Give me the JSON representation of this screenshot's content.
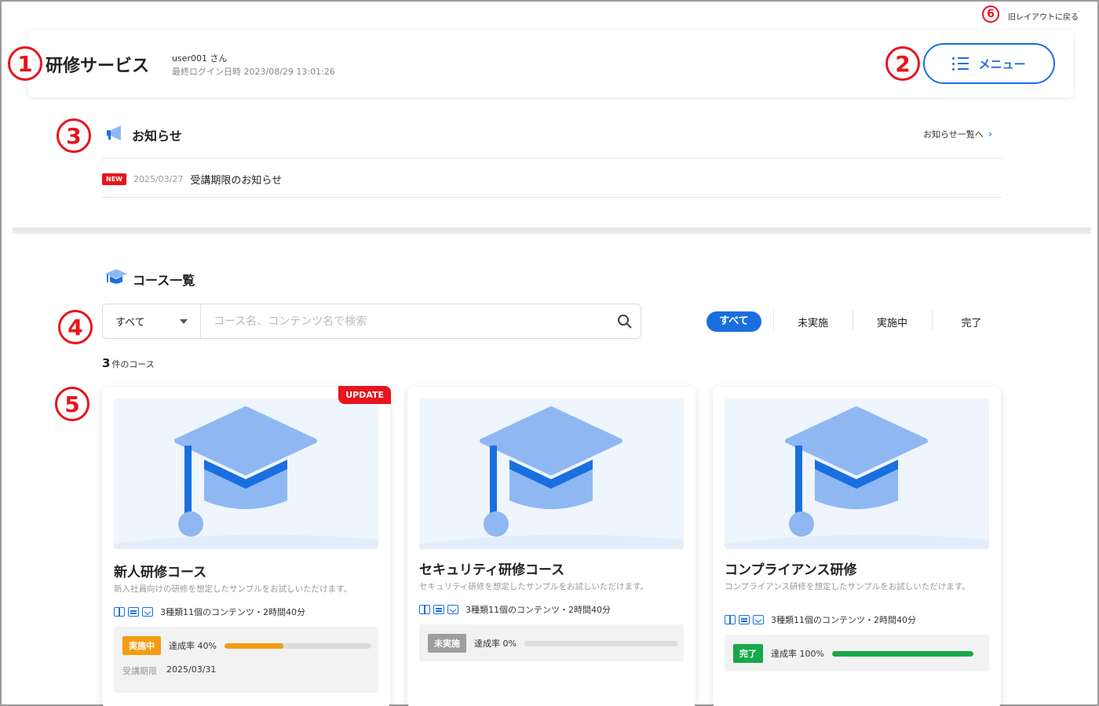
{
  "top_link": "旧レイアウトに戻る",
  "header": {
    "app_title": "研修サービス",
    "user": "user001 さん",
    "last_login": "最終ログイン日時 2023/08/29 13:01:26",
    "menu_label": "メニュー"
  },
  "markers": [
    "1",
    "2",
    "3",
    "4",
    "5",
    "6"
  ],
  "notice": {
    "title": "お知らせ",
    "list_link": "お知らせ一覧へ",
    "items": [
      {
        "badge": "NEW",
        "date": "2025/03/27",
        "text": "受講期限のお知らせ"
      }
    ]
  },
  "courses": {
    "title": "コース一覧",
    "search": {
      "select_value": "すべて",
      "placeholder": "コース名、コンテンツ名で検索"
    },
    "filters": [
      "すべて",
      "未実施",
      "実施中",
      "完了"
    ],
    "active_filter": "すべて",
    "count_number": "3",
    "count_suffix": "件のコース",
    "cards": [
      {
        "ribbon": "UPDATE",
        "name": "新人研修コース",
        "desc": "新入社員向けの研修を想定したサンプルをお試しいただけます。",
        "meta": "3種類11個のコンテンツ・2時間40分",
        "status": "実施中",
        "status_color": "#f39c12",
        "progress_label": "達成率 40%",
        "progress": 40,
        "bar_color": "#f39c12",
        "deadline_label": "受講期限",
        "deadline": "2025/03/31"
      },
      {
        "name": "セキュリティ研修コース",
        "desc": "セキュリティ研修を想定したサンプルをお試しいただけます。",
        "meta": "3種類11個のコンテンツ・2時間40分",
        "status": "未実施",
        "status_color": "#9e9e9e",
        "progress_label": "達成率 0%",
        "progress": 0,
        "bar_color": "#9e9e9e"
      },
      {
        "name": "コンプライアンス研修",
        "desc": "コンプライアンス研修を想定したサンプルをお試しいただけます。",
        "meta": "3種類11個のコンテンツ・2時間40分",
        "status": "完了",
        "status_color": "#17a84b",
        "progress_label": "達成率 100%",
        "progress": 100,
        "bar_color": "#17a84b"
      }
    ]
  },
  "colors": {
    "accent": "#1a6fe0",
    "marker": "#e8141b",
    "new_badge": "#e8141b"
  },
  "icons": {
    "menu": "list-icon",
    "notice": "megaphone-icon",
    "courses": "graduation-cap-icon",
    "search": "search-icon",
    "thumbnail": "graduation-cap-icon",
    "content_types": [
      "book-icon",
      "film-icon",
      "test-icon"
    ]
  }
}
